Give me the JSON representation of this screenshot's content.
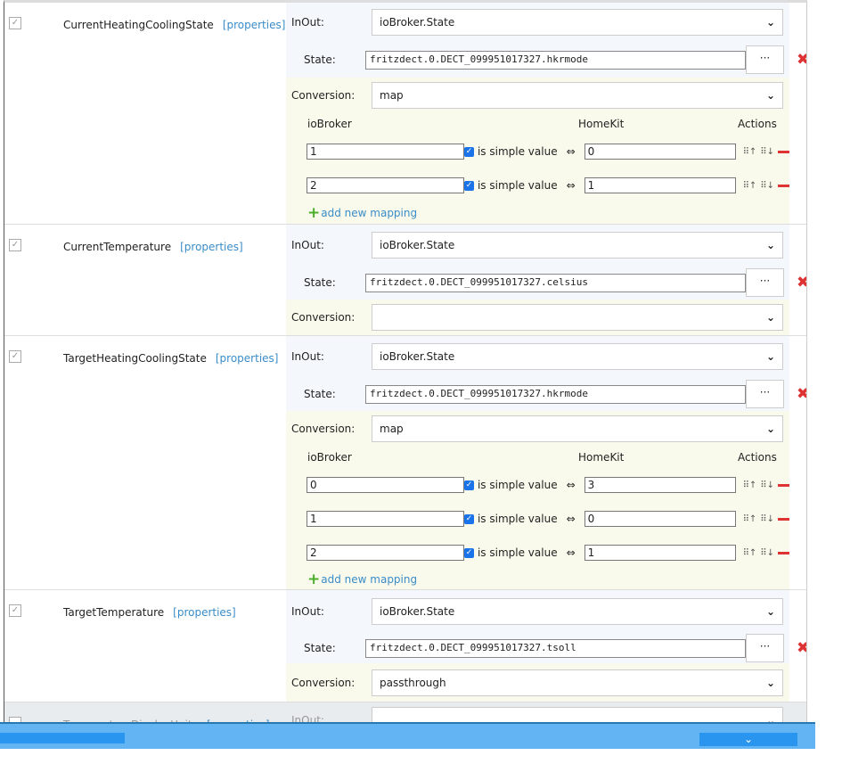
{
  "labels": {
    "inout": "InOut:",
    "state": "State:",
    "conversion": "Conversion:",
    "iobroker": "ioBroker",
    "homekit": "HomeKit",
    "actions": "Actions",
    "simple": "is simple value",
    "arrow": "⇔",
    "add": "add new mapping",
    "properties": "[properties]",
    "dots": "···",
    "remove": "✖",
    "up": "⠿↑",
    "down": "⠿↓"
  },
  "sections": [
    {
      "name": "CurrentHeatingCoolingState",
      "inout": "ioBroker.State",
      "state": "fritzdect.0.DECT_099951017327.hkrmode",
      "conversion": "map",
      "mappings": [
        {
          "iobroker": "1",
          "homekit": "0"
        },
        {
          "iobroker": "2",
          "homekit": "1"
        }
      ]
    },
    {
      "name": "CurrentTemperature",
      "inout": "ioBroker.State",
      "state": "fritzdect.0.DECT_099951017327.celsius",
      "conversion": ""
    },
    {
      "name": "TargetHeatingCoolingState",
      "inout": "ioBroker.State",
      "state": "fritzdect.0.DECT_099951017327.hkrmode",
      "conversion": "map",
      "mappings": [
        {
          "iobroker": "0",
          "homekit": "3"
        },
        {
          "iobroker": "1",
          "homekit": "0"
        },
        {
          "iobroker": "2",
          "homekit": "1"
        }
      ]
    },
    {
      "name": "TargetTemperature",
      "inout": "ioBroker.State",
      "state": "fritzdect.0.DECT_099951017327.tsoll",
      "conversion": "passthrough"
    },
    {
      "name": "TemperatureDisplayUnits"
    }
  ]
}
